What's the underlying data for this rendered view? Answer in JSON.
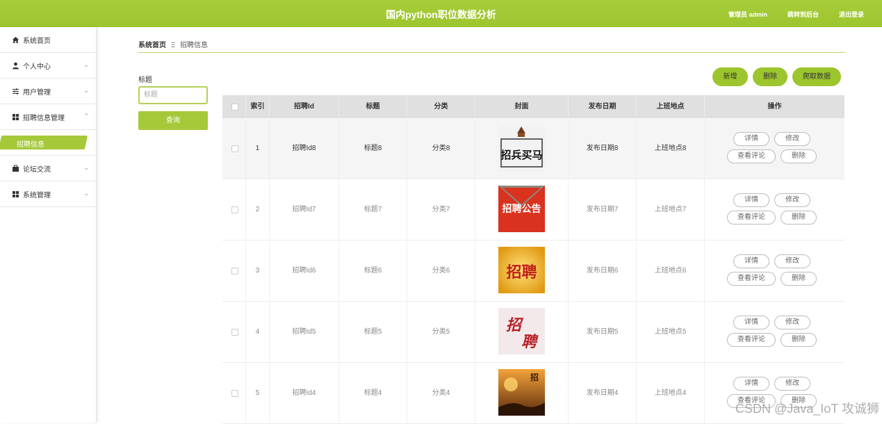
{
  "header": {
    "title": "国内python职位数据分析",
    "admin": "管理员 admin",
    "dashboard": "跳转到后台",
    "logout": "退出登录"
  },
  "sidebar": {
    "items": [
      {
        "label": "系统首页",
        "icon": "home-icon"
      },
      {
        "label": "个人中心",
        "icon": "user-icon"
      },
      {
        "label": "用户管理",
        "icon": "sliders-icon"
      },
      {
        "label": "招聘信息管理",
        "icon": "grid-icon"
      },
      {
        "label": "招聘信息",
        "icon": ""
      },
      {
        "label": "论坛交流",
        "icon": "briefcase-icon"
      },
      {
        "label": "系统管理",
        "icon": "grid-icon"
      }
    ]
  },
  "breadcrumb": {
    "home": "系统首页",
    "sep": "Ξ",
    "current": "招聘信息"
  },
  "search": {
    "label": "标题",
    "placeholder": "标题",
    "button": "查询"
  },
  "actions": {
    "add": "新增",
    "delete": "删除",
    "crawl": "爬取数据"
  },
  "table": {
    "headers": [
      "索引",
      "招聘Id",
      "标题",
      "分类",
      "封面",
      "发布日期",
      "上班地点",
      "操作"
    ],
    "ops": {
      "detail": "详情",
      "edit": "修改",
      "comments": "查看评论",
      "delete": "删除"
    },
    "rows": [
      {
        "index": "1",
        "id": "招聘Id8",
        "title": "标题8",
        "category": "分类8",
        "date": "发布日期8",
        "place": "上班地点8"
      },
      {
        "index": "2",
        "id": "招聘Id7",
        "title": "标题7",
        "category": "分类7",
        "date": "发布日期7",
        "place": "上班地点7"
      },
      {
        "index": "3",
        "id": "招聘Id6",
        "title": "标题6",
        "category": "分类6",
        "date": "发布日期6",
        "place": "上班地点6"
      },
      {
        "index": "4",
        "id": "招聘Id5",
        "title": "标题5",
        "category": "分类5",
        "date": "发布日期5",
        "place": "上班地点5"
      },
      {
        "index": "5",
        "id": "招聘Id4",
        "title": "标题4",
        "category": "分类4",
        "date": "发布日期4",
        "place": "上班地点4"
      }
    ]
  },
  "watermark": "CSDN @Java_IoT 攻诚狮",
  "colors": {
    "accent": "#9cc52e"
  }
}
